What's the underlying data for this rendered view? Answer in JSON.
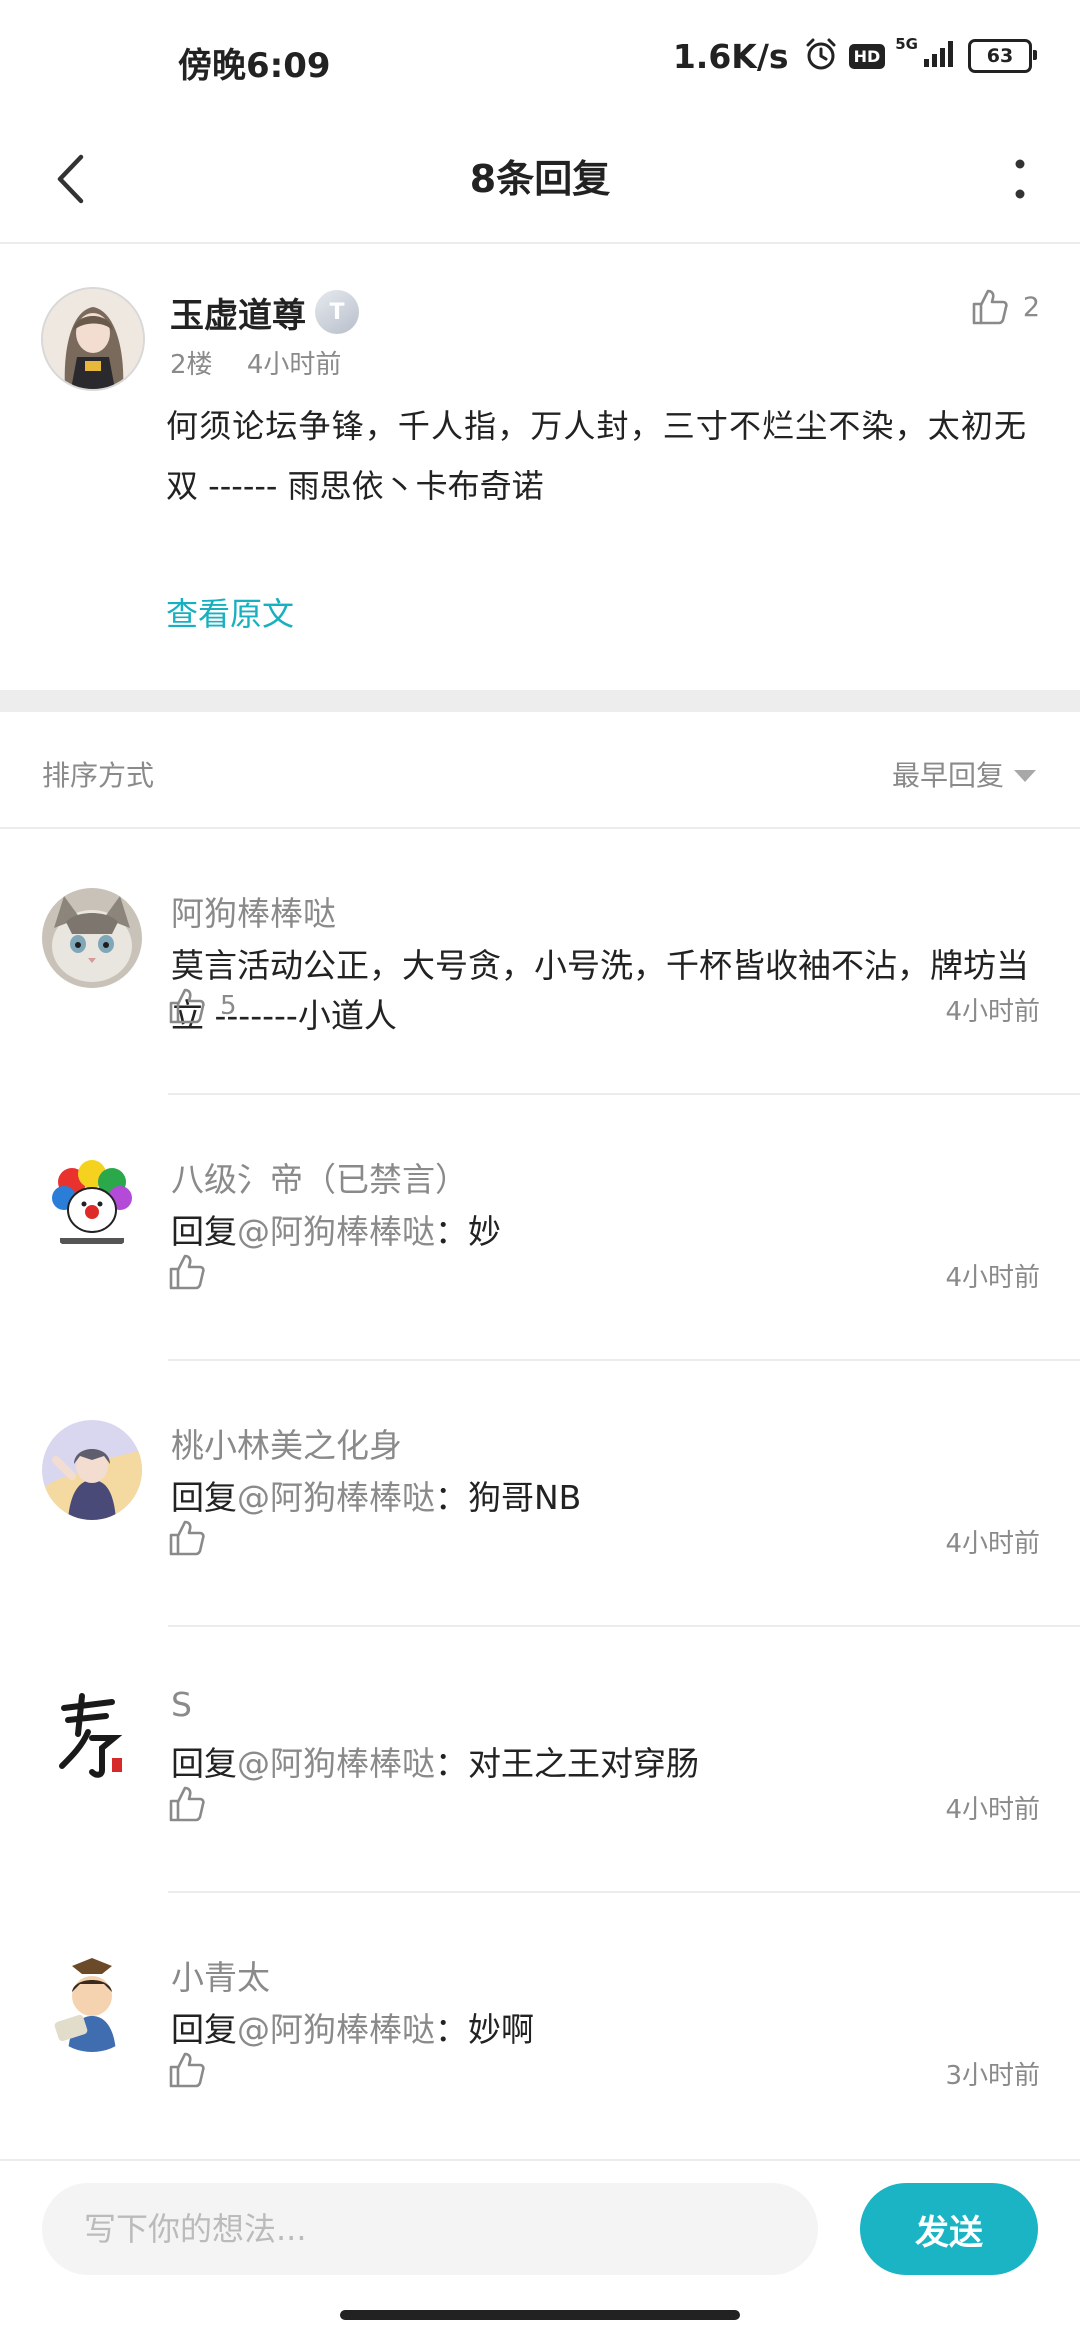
{
  "status_bar": {
    "time": "傍晚6:09",
    "net_speed": "1.6K/s",
    "hd_label": "HD",
    "network_label": "5G",
    "battery": "63"
  },
  "nav": {
    "title": "8条回复"
  },
  "main_post": {
    "author": "玉虚道尊",
    "rank_badge": "T",
    "floor": "2楼",
    "time": "4小时前",
    "likes": "2",
    "text": "何须论坛争锋，千人指，万人封，三寸不烂尘不染，太初无双 ------ 雨思依丶卡布奇诺",
    "view_original": "查看原文"
  },
  "sort": {
    "label": "排序方式",
    "selected": "最早回复"
  },
  "replies": [
    {
      "author": "阿狗棒棒哒",
      "prefix": "",
      "mention": "",
      "text": "莫言活动公正，大号贪，小号洗，千杯皆收袖不沾，牌坊当立 -------小道人",
      "likes": "5",
      "time": "4小时前"
    },
    {
      "author": "八级氵帝（已禁言）",
      "prefix": "回复",
      "mention": "@阿狗棒棒哒",
      "text": "：妙",
      "likes": "",
      "time": "4小时前"
    },
    {
      "author": "桃小林美之化身",
      "prefix": "回复",
      "mention": "@阿狗棒棒哒",
      "text": "：狗哥NB",
      "likes": "",
      "time": "4小时前"
    },
    {
      "author": "S",
      "prefix": "回复",
      "mention": "@阿狗棒棒哒",
      "text": "：对王之王对穿肠",
      "likes": "",
      "time": "4小时前"
    },
    {
      "author": "小青太",
      "prefix": "回复",
      "mention": "@阿狗棒棒哒",
      "text": "：妙啊",
      "likes": "",
      "time": "3小时前"
    }
  ],
  "composer": {
    "placeholder": "写下你的想法...",
    "send_label": "发送"
  },
  "colors": {
    "accent": "#1ab4c5",
    "link": "#17b0c0",
    "muted_text": "#8a8a8a",
    "divider": "#ececec"
  }
}
